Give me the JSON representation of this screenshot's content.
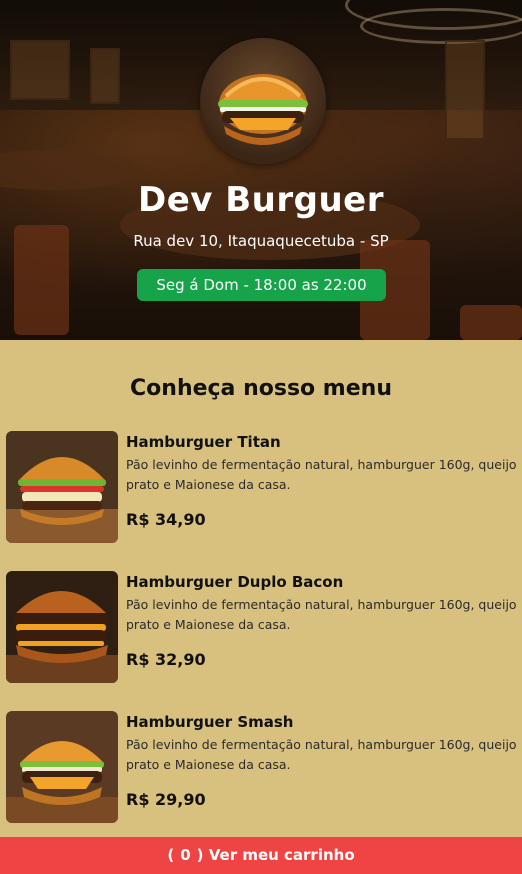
{
  "restaurant": {
    "name": "Dev Burguer",
    "address": "Rua dev 10, Itaquaquecetuba - SP",
    "hours": "Seg á Dom - 18:00 as 22:00"
  },
  "menu": {
    "title": "Conheça nosso menu",
    "items": [
      {
        "name": "Hamburguer Titan",
        "description": "Pão levinho de fermentação natural, hamburguer 160g, queijo prato e Maionese da casa.",
        "price": "R$ 34,90"
      },
      {
        "name": "Hamburguer Duplo Bacon",
        "description": "Pão levinho de fermentação natural, hamburguer 160g, queijo prato e Maionese da casa.",
        "price": "R$ 32,90"
      },
      {
        "name": "Hamburguer Smash",
        "description": "Pão levinho de fermentação natural, hamburguer 160g, queijo prato e Maionese da casa.",
        "price": "R$ 29,90"
      }
    ]
  },
  "cart": {
    "open_paren": "(",
    "count": "0",
    "close_paren": ")",
    "label": "Ver meu carrinho"
  },
  "colors": {
    "page_background": "#d8c17f",
    "hours_badge": "#16a34a",
    "cart_bar": "#ef4444"
  }
}
